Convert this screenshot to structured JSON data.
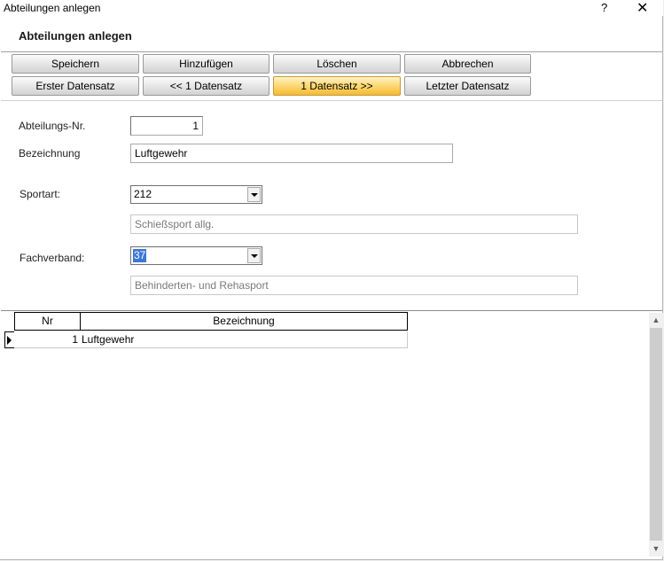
{
  "window": {
    "title": "Abteilungen anlegen",
    "help_glyph": "?",
    "close_glyph": "✕"
  },
  "header": {
    "label": "Abteilungen anlegen"
  },
  "toolbar": {
    "save": "Speichern",
    "add": "Hinzufügen",
    "delete": "Löschen",
    "cancel": "Abbrechen",
    "first": "Erster Datensatz",
    "prev": "<< 1 Datensatz",
    "next": "1 Datensatz >>",
    "last": "Letzter Datensatz"
  },
  "form": {
    "nr_label": "Abteilungs-Nr.",
    "nr_value": "1",
    "name_label": "Bezeichnung",
    "name_value": "Luftgewehr",
    "sport_label": "Sportart:",
    "sport_value": "212",
    "sport_desc": "Schießsport allg.",
    "verband_label": "Fachverband:",
    "verband_value": "37",
    "verband_desc": "Behinderten- und Rehasport"
  },
  "grid": {
    "columns": [
      "Nr",
      "Bezeichnung"
    ],
    "rows": [
      {
        "nr": "1",
        "bezeichnung": "Luftgewehr"
      }
    ]
  },
  "colors": {
    "active_button": "#fcd46a",
    "selection": "#3a78d4"
  }
}
